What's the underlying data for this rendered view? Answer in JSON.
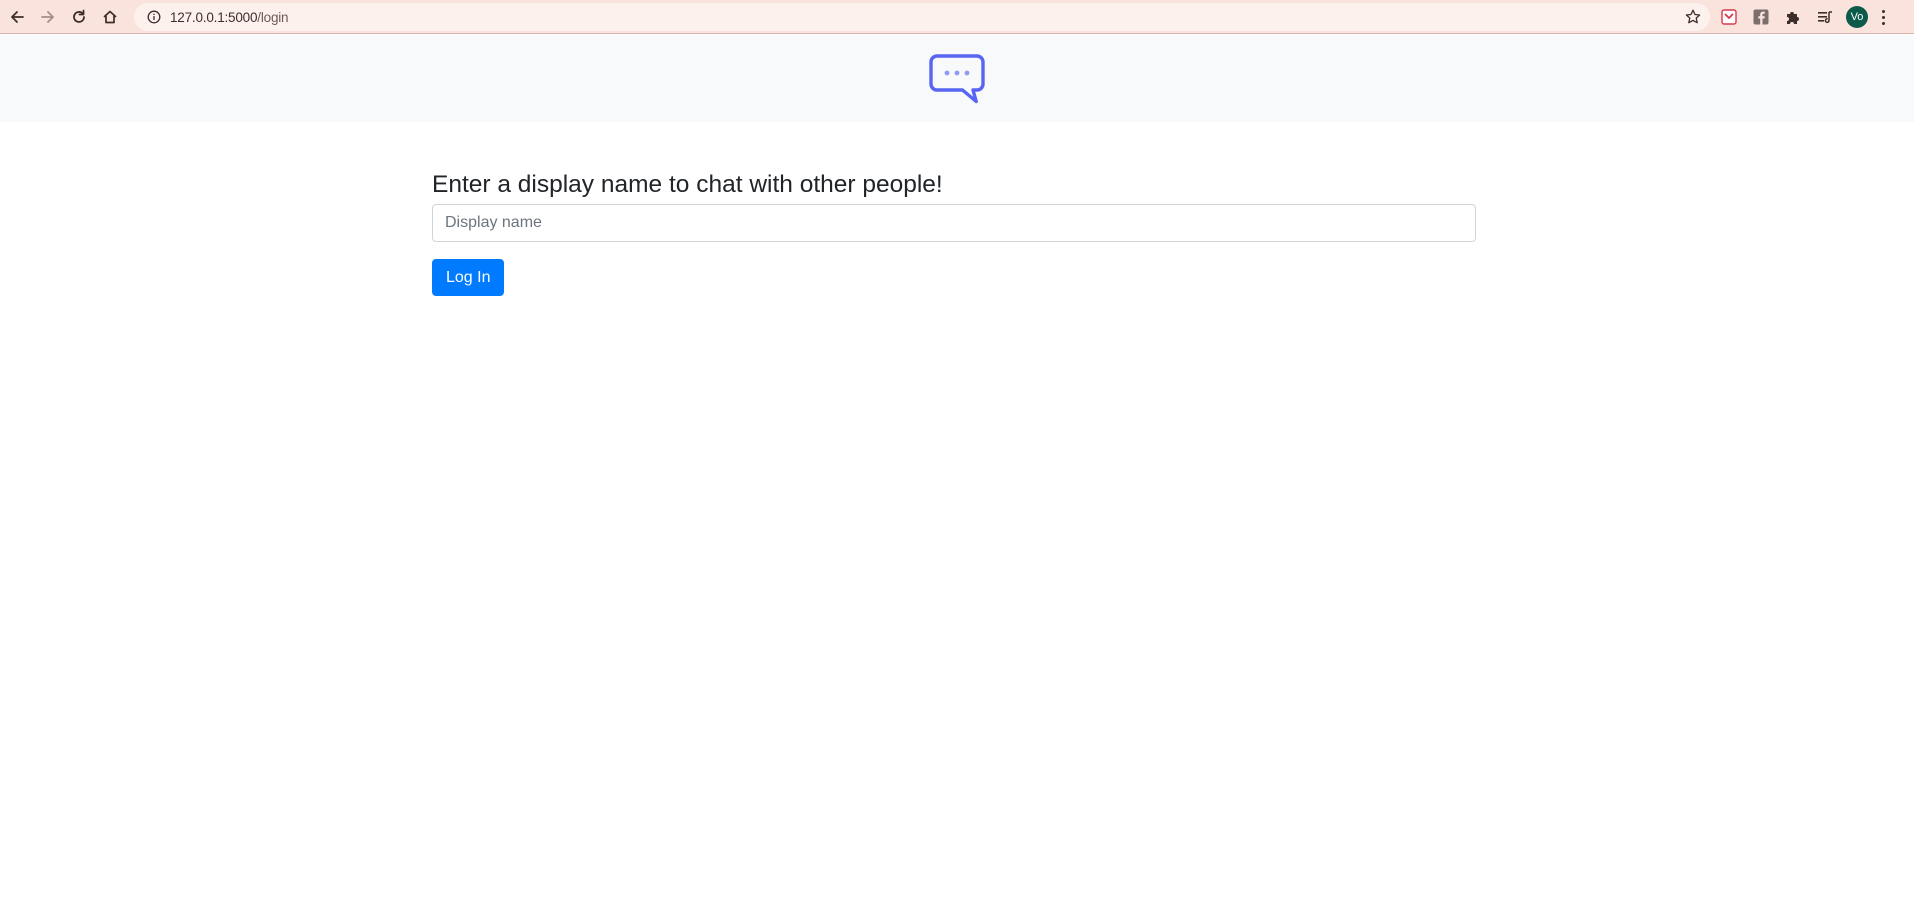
{
  "browser": {
    "url_host": "127.0.0.1:5000",
    "url_path": "/login",
    "profile_initials": "Vo",
    "icons": {
      "back": "back-arrow-icon",
      "forward": "forward-arrow-icon",
      "reload": "reload-icon",
      "home": "home-icon",
      "site_info": "info-icon",
      "bookmark": "star-icon",
      "extensions": [
        "pocket-icon",
        "facebook-icon",
        "puzzle-icon",
        "media-queue-icon"
      ],
      "menu": "kebab-menu-icon"
    },
    "colors": {
      "toolbar": "#fbe3dd",
      "omnibox": "#fdf1ee",
      "avatar": "#0b5a4a"
    }
  },
  "header": {
    "logo": "chat-bubble-icon",
    "logo_color": "#5865f2",
    "background": "#f8f9fa"
  },
  "login": {
    "title": "Enter a display name to chat with other people!",
    "input_placeholder": "Display name",
    "input_value": "",
    "button_label": "Log In",
    "button_color": "#007bff"
  }
}
